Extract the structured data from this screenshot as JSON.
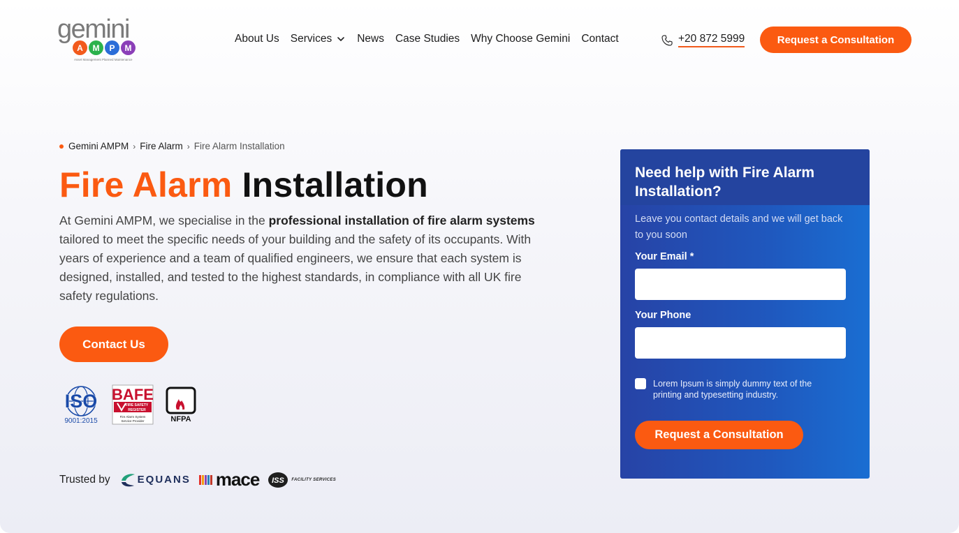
{
  "logo": {
    "word": "gemini",
    "letters": [
      "A",
      "M",
      "P",
      "M"
    ],
    "tagline": "Asset Management Planned Maintenance"
  },
  "colors": {
    "accent": "#fb5a11",
    "card_blue": "#2743a6",
    "logo_letters": [
      "#f25a1c",
      "#2bb24c",
      "#2b6dd8",
      "#8b3fb8"
    ]
  },
  "nav": {
    "items": [
      {
        "label": "About Us"
      },
      {
        "label": "Services",
        "icon": "chevron-down-icon"
      },
      {
        "label": "News"
      },
      {
        "label": "Case Studies"
      },
      {
        "label": "Why Choose Gemini"
      },
      {
        "label": "Contact"
      }
    ],
    "phone": {
      "icon": "phone-icon",
      "number": "+20 872 5999"
    },
    "cta_label": "Request a Consultation"
  },
  "breadcrumb": {
    "items": [
      "Gemini AMPM",
      "Fire Alarm",
      "Fire Alarm Installation"
    ],
    "separator": "›"
  },
  "hero": {
    "title_accent": "Fire Alarm",
    "title_rest": "Installation",
    "intro_start": "At Gemini AMPM, we specialise in the ",
    "intro_bold": "professional installation of fire alarm systems",
    "intro_end": " tailored to meet the specific needs of your building and the safety of its occupants. With years of experience and a team of qualified engineers, we ensure that each system is designed, installed, and tested to the highest standards, in compliance with all UK fire safety regulations.",
    "contact_label": "Contact Us"
  },
  "certifications": {
    "iso": {
      "name": "ISO",
      "standard": "9001:2015"
    },
    "bafe": {
      "name": "BAFE",
      "line1": "FIRE SAFETY",
      "line2": "REGISTER",
      "caption1": "Fire Alarm System",
      "caption2": "Service Provider"
    },
    "nfpa": {
      "name": "NFPA"
    }
  },
  "trusted": {
    "label": "Trusted by",
    "brands": {
      "equans": "EQUANS",
      "mace": "mace",
      "iss": "ISS",
      "iss_sub": "FACILITY SERVICES"
    }
  },
  "form": {
    "title": "Need help with Fire Alarm Installation?",
    "subtitle": "Leave you contact details and we will get back to you soon",
    "email_label": "Your Email *",
    "email_value": "",
    "phone_label": "Your Phone",
    "phone_value": "",
    "consent_text": "Lorem Ipsum is simply dummy text of the printing and typesetting industry.",
    "submit_label": "Request a Consultation"
  }
}
